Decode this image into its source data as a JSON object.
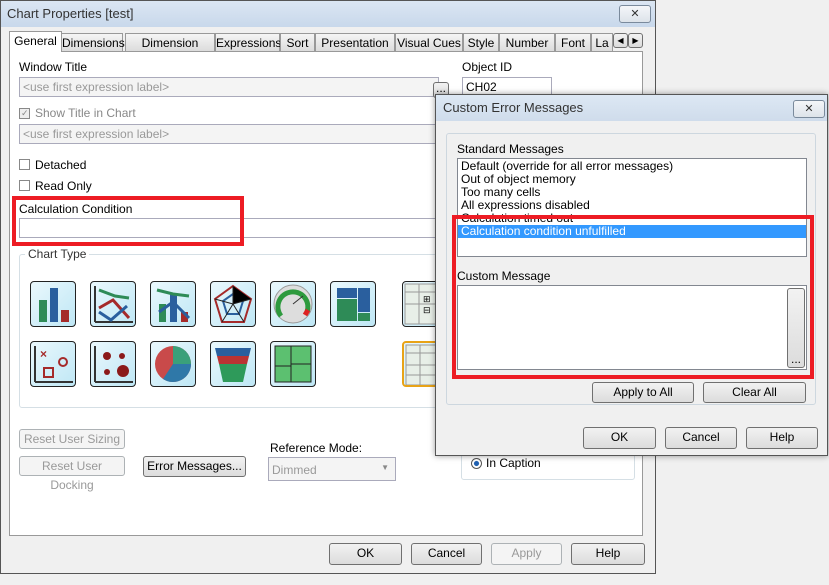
{
  "main": {
    "title": "Chart Properties [test]",
    "close_icon": "close-icon",
    "tabs": [
      "General",
      "Dimensions",
      "Dimension Limits",
      "Expressions",
      "Sort",
      "Presentation",
      "Visual Cues",
      "Style",
      "Number",
      "Font",
      "La"
    ],
    "window_title_label": "Window Title",
    "window_title_placeholder": "<use first expression label>",
    "object_id_label": "Object ID",
    "object_id_value": "CH02",
    "show_title_label": "Show Title in Chart",
    "show_title_placeholder": "<use first expression label>",
    "detached_label": "Detached",
    "read_only_label": "Read Only",
    "calc_condition_label": "Calculation Condition",
    "calc_condition_value": "",
    "chart_type_label": "Chart Type",
    "chart_types": [
      "bar-chart",
      "line-chart",
      "combo-chart",
      "radar-chart",
      "gauge-chart",
      "mekko-chart",
      "pivot-table",
      "scatter-chart",
      "grid-chart",
      "pie-chart",
      "funnel-chart",
      "block-chart",
      "straight-table"
    ],
    "selected_chart_type": "straight-table",
    "reset_sizing": "Reset User Sizing",
    "reset_docking": "Reset User Docking",
    "error_messages": "Error Messages...",
    "reference_mode_label": "Reference Mode:",
    "reference_mode_value": "Dimmed",
    "in_caption": "In Caption",
    "ok": "OK",
    "cancel": "Cancel",
    "apply": "Apply",
    "help": "Help"
  },
  "error_dialog": {
    "title": "Custom Error Messages",
    "standard_label": "Standard Messages",
    "messages": [
      "Default (override for all error messages)",
      "Out of object memory",
      "Too many cells",
      "All expressions disabled",
      "Calculation timed out",
      "Calculation condition unfulfilled"
    ],
    "selected_index": 5,
    "custom_label": "Custom Message",
    "custom_value": "",
    "ellipsis": "...",
    "apply_all": "Apply to All",
    "clear_all": "Clear All",
    "ok": "OK",
    "cancel": "Cancel",
    "help": "Help"
  },
  "colors": {
    "highlight": "#ed1c24",
    "selection": "#3399ff"
  }
}
